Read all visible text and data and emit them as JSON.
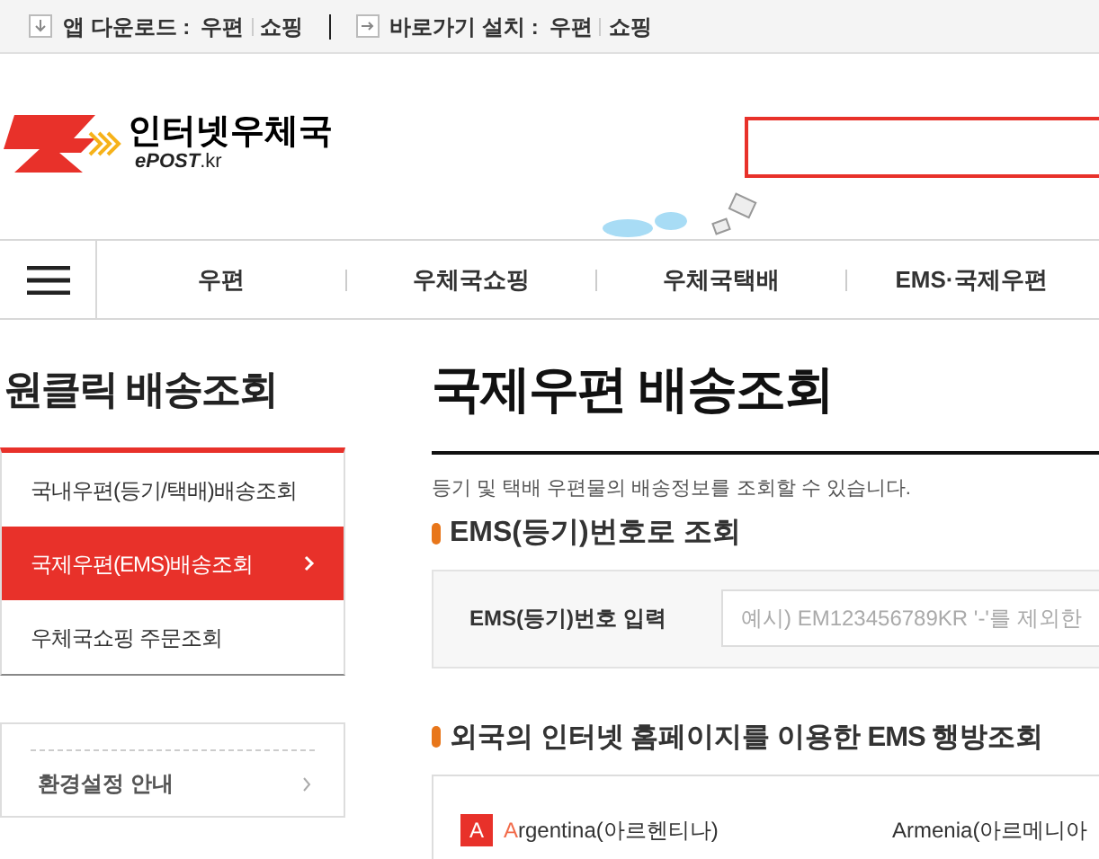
{
  "top_bar": {
    "groups": [
      {
        "label": "앱 다운로드 :",
        "links": [
          "우편",
          "쇼핑"
        ]
      },
      {
        "label": "바로가기 설치 :",
        "links": [
          "우편",
          "쇼핑"
        ]
      }
    ]
  },
  "logo": {
    "name": "인터넷우체국",
    "sub": "ePOST",
    "domain": ".kr"
  },
  "nav": {
    "items": [
      "우편",
      "우체국쇼핑",
      "우체국택배",
      "EMS·국제우편"
    ]
  },
  "sidebar": {
    "title": "원클릭 배송조회",
    "items": [
      {
        "label": "국내우편(등기/택배)배송조회",
        "selected": false
      },
      {
        "label": "국제우편(EMS)배송조회",
        "selected": true
      },
      {
        "label": "우체국쇼핑 주문조회",
        "selected": false
      }
    ],
    "settings": "환경설정 안내"
  },
  "main": {
    "title": "국제우편 배송조회",
    "description": "등기 및 택배 우편물의 배송정보를 조회할 수 있습니다.",
    "section1": "EMS(등기)번호로 조회",
    "input_label": "EMS(등기)번호 입력",
    "placeholder": "예시) EM123456789KR '-'를 제외한",
    "section2": "외국의 인터넷 홈페이지를 이용한 EMS 행방조회",
    "letter": "A",
    "countries": [
      {
        "lead": "A",
        "rest": "rgentina(아르헨티나)",
        "highlight": true
      },
      {
        "lead": "A",
        "rest": "rmenia(아르메니아",
        "highlight": false
      }
    ]
  }
}
